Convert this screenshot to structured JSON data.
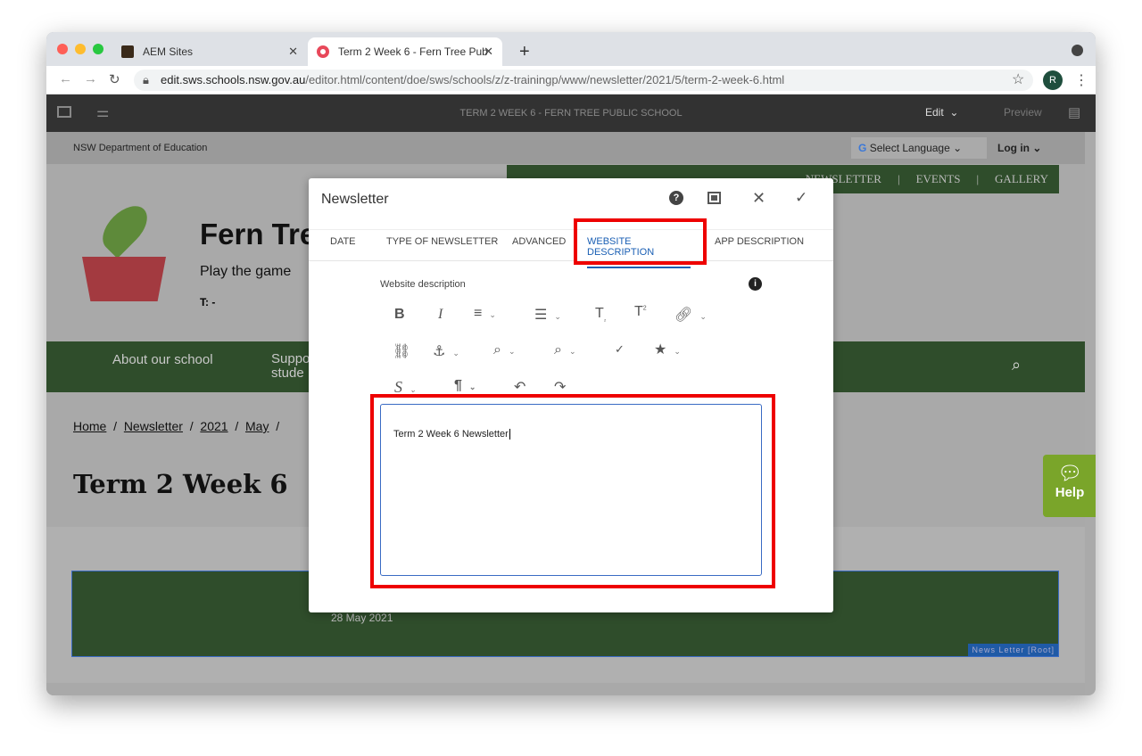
{
  "browser": {
    "tabs": [
      {
        "label": "AEM Sites"
      },
      {
        "label": "Term 2 Week 6 - Fern Tree Pub"
      }
    ],
    "url_host": "edit.sws.schools.nsw.gov.au",
    "url_path": "/editor.html/content/doe/sws/schools/z/z-trainingp/www/newsletter/2021/5/term-2-week-6.html",
    "profile_initial": "R"
  },
  "editor": {
    "title": "TERM 2 WEEK 6 - FERN TREE PUBLIC SCHOOL",
    "mode": "Edit",
    "preview": "Preview"
  },
  "site": {
    "department": "NSW Department of Education",
    "select_language": "Select Language",
    "login": "Log in",
    "top_nav": [
      "NEWSLETTER",
      "EVENTS",
      "GALLERY"
    ],
    "school_name": "Fern Tre",
    "tagline": "Play the game",
    "phone": "T: -",
    "main_nav": [
      "About our school",
      "Suppo\nstude"
    ],
    "breadcrumb": [
      "Home",
      "Newsletter",
      "2021",
      "May"
    ],
    "page_title": "Term 2 Week 6",
    "date": "28 May 2021",
    "component_label": "News Letter [Root]",
    "help": "Help"
  },
  "dialog": {
    "title": "Newsletter",
    "tabs": [
      "DATE",
      "TYPE OF NEWSLETTER",
      "ADVANCED",
      "WEBSITE DESCRIPTION",
      "APP DESCRIPTION"
    ],
    "active_tab": "WEBSITE DESCRIPTION",
    "field_label": "Website description",
    "field_value": "Term 2 Week 6 Newsletter"
  },
  "colors": {
    "green": "#2f4d2b",
    "highlight": "#e00000",
    "accent": "#1a5fb4",
    "help": "#7aa52a"
  }
}
